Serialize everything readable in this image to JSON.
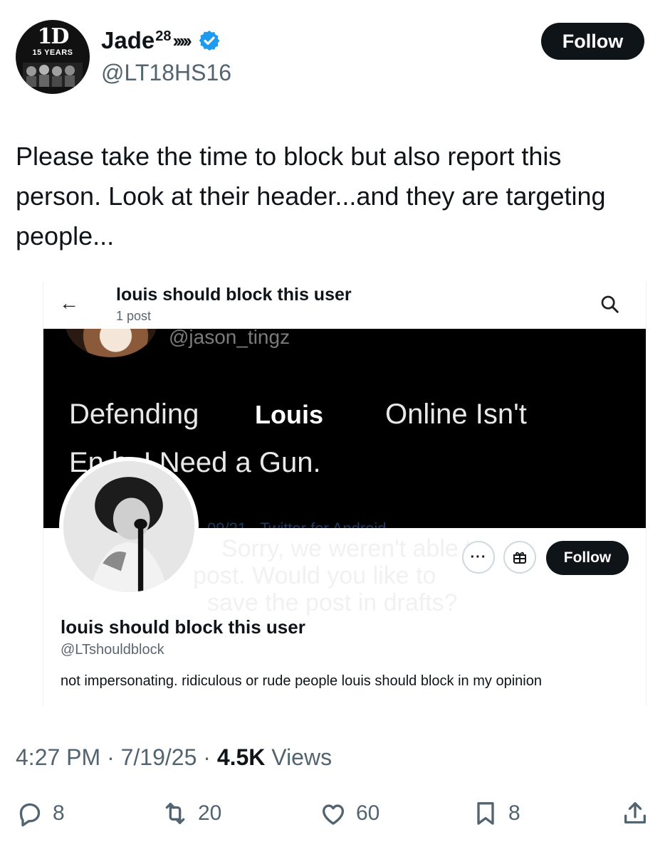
{
  "author": {
    "avatar_logo": "1D",
    "avatar_sub": "15 YEARS",
    "name": "Jade",
    "name_sup": "28",
    "name_suffix": "›››››",
    "handle": "@LT18HS16",
    "follow_label": "Follow",
    "verified_color": "#1d9bf0"
  },
  "tweet": {
    "text": "Please take the time to block but also report this person. Look at their header...and they are targeting people..."
  },
  "embed": {
    "back_icon": "back-arrow-icon",
    "title": "louis should block this user",
    "posts": "1 post",
    "banner": {
      "handle": "@jason_tingz",
      "line1a": "Defending",
      "line1b": "Louis",
      "line1c": "Online Isn't",
      "line2": "En    h. I Need a Gun.",
      "faint": "09/21 · Twitter for Android"
    },
    "ghost_text": [
      "Sorry, we weren't able to",
      "post. Would you like to",
      "save the post in drafts?"
    ],
    "more_label": "···",
    "follow_label": "Follow",
    "profile_name": "louis should block this user",
    "profile_handle": "@LTshouldblock",
    "bio": "not impersonating. ridiculous or rude people louis should block in my opinion"
  },
  "meta": {
    "time": "4:27 PM",
    "date": "7/19/25",
    "views_count": "4.5K",
    "views_label": "Views"
  },
  "actions": {
    "replies": "8",
    "reposts": "20",
    "likes": "60",
    "bookmarks": "8"
  }
}
